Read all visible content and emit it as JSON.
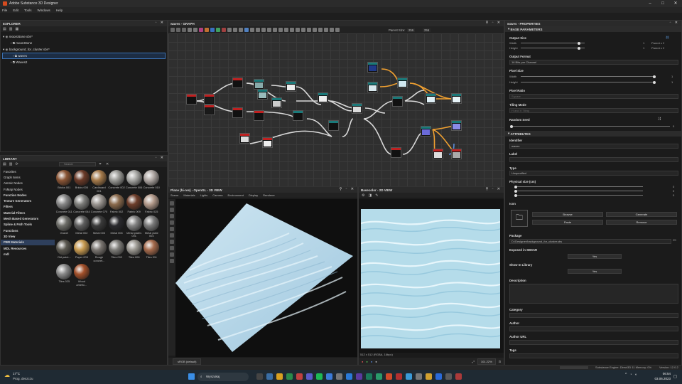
{
  "app": {
    "title": "Adobe Substance 3D Designer",
    "menu": [
      "File",
      "Edit",
      "Tools",
      "Windows",
      "Help"
    ]
  },
  "explorer": {
    "title": "EXPLORER",
    "items": [
      {
        "label": "moonStone.sbs*",
        "level": 0
      },
      {
        "label": "moonStone",
        "level": 1
      },
      {
        "label": "background_for_cluster.sbs*",
        "level": 0
      },
      {
        "label": "waves",
        "level": 1
      },
      {
        "label": "Waves2",
        "level": 1
      }
    ]
  },
  "library": {
    "title": "LIBRARY",
    "search_placeholder": "Search",
    "categories": [
      {
        "label": "Favorites",
        "bold": false
      },
      {
        "label": "Graph Items",
        "bold": false
      },
      {
        "label": "Atomic Nodes",
        "bold": false
      },
      {
        "label": "FxMap Nodes",
        "bold": false
      },
      {
        "label": "Function Nodes",
        "bold": true
      },
      {
        "label": "Texture Generators",
        "bold": true
      },
      {
        "label": "Filters",
        "bold": true
      },
      {
        "label": "Material Filters",
        "bold": true
      },
      {
        "label": "Mesh Based Generators",
        "bold": true
      },
      {
        "label": "Spline & Path Tools",
        "bold": true
      },
      {
        "label": "Functions",
        "bold": true
      },
      {
        "label": "3D View",
        "bold": true
      },
      {
        "label": "PBR Materials",
        "bold": true
      },
      {
        "label": "MDL Resources",
        "bold": true
      },
      {
        "label": "mdl",
        "bold": true
      }
    ],
    "materials": [
      {
        "label": "Bricks 001",
        "color": "#8a5535"
      },
      {
        "label": "Bricks 005",
        "color": "#6b3a28"
      },
      {
        "label": "Cardboard 001",
        "color": "#a57a4a"
      },
      {
        "label": "Concrete 002",
        "color": "#9a9a96"
      },
      {
        "label": "Concrete 006",
        "color": "#a8a8a5"
      },
      {
        "label": "Concrete 010",
        "color": "#b0a8a4"
      },
      {
        "label": "Concrete 011",
        "color": "#878787"
      },
      {
        "label": "Concrete 044",
        "color": "#7d7d7a"
      },
      {
        "label": "Concrete 070",
        "color": "#9a9590"
      },
      {
        "label": "Fabric 002",
        "color": "#8a6a4c"
      },
      {
        "label": "Fabric 009",
        "color": "#6d3d2a"
      },
      {
        "label": "Fabric 025",
        "color": "#b39a8b"
      },
      {
        "label": "Gravel",
        "color": "#6e6e69"
      },
      {
        "label": "Metal 002",
        "color": "#5e5e5e"
      },
      {
        "label": "Metal 003",
        "color": "#3a3a3a"
      },
      {
        "label": "Metal 006",
        "color": "#2a2a2e"
      },
      {
        "label": "Metal plates 001",
        "color": "#828282"
      },
      {
        "label": "Metal plate 004",
        "color": "#7a7a7a"
      },
      {
        "label": "Old paint...",
        "color": "#5b5850"
      },
      {
        "label": "Paper 005",
        "color": "#c79a50"
      },
      {
        "label": "Rough concret...",
        "color": "#7a7570"
      },
      {
        "label": "Tiles 002",
        "color": "#7d7c78"
      },
      {
        "label": "Tiles 008",
        "color": "#9b9891"
      },
      {
        "label": "Tiles 011",
        "color": "#a56a4c"
      },
      {
        "label": "Tiles 025",
        "color": "#8a8a8a"
      },
      {
        "label": "Wood americ...",
        "color": "#a3502a"
      }
    ]
  },
  "graph": {
    "title": "waves - GRAPH",
    "parent_size_label": "Parent Size:",
    "size_a": "256",
    "size_b": "256"
  },
  "view3d": {
    "title": "Plane (hi-res) - OpenGL - 3D VIEW",
    "menu": [
      "Scene",
      "Materials",
      "Lights",
      "Camera",
      "Environment",
      "Display",
      "Renderer"
    ],
    "colorspace": "sRGB (default)"
  },
  "view2d": {
    "title": "Basecolor - 2D VIEW",
    "status": "512 x 512 (RGBA, 16bpc)",
    "zoom": "101.22%"
  },
  "properties": {
    "title": "waves - PROPERTIES",
    "base_section": "BASE PARAMETERS",
    "output_size_label": "Output Size",
    "width_label": "Width",
    "height_label": "Height",
    "width_value": "1",
    "height_value": "1",
    "width_rel": "Parent x 2",
    "height_rel": "Parent x 2",
    "output_format_label": "Output Format",
    "output_format_value": "16 Bits per Channel",
    "pixel_size_label": "Pixel Size",
    "px_width": "1",
    "px_height": "1",
    "pixel_ratio_label": "Pixel Ratio",
    "pixel_ratio_value": "Square",
    "tiling_label": "Tiling Mode",
    "tiling_value": "H and V Tiling",
    "random_seed_label": "Random Seed",
    "random_seed_value": "0",
    "attributes_section": "ATTRIBUTES",
    "identifier_label": "Identifier",
    "identifier_value": "waves",
    "label_label": "Label",
    "type_label": "Type",
    "type_value": "Unspecified",
    "physical_size_label": "Physical size (cm)",
    "physical_size_values": [
      "0",
      "0",
      "0"
    ],
    "icon_label": "Icon",
    "browse_label": "Browse",
    "generate_label": "Generate",
    "paste_label": "Paste",
    "remove_label": "Remove",
    "package_label": "Package",
    "package_value": "D:/Designer/background_for_cluster.sbs",
    "exposed_label": "Exposed in SBSAR",
    "exposed_value": "Yes",
    "show_library_label": "Show In Library",
    "show_library_value": "Yes",
    "description_label": "Description",
    "category_label": "Category",
    "author_label": "Author",
    "author_url_label": "Author URL",
    "tags_label": "Tags"
  },
  "statusbar": {
    "engine": "Substance Engine: Direct3D 11  Memory: 0%",
    "version": "Version: 12.0.2"
  },
  "taskbar": {
    "weather_temp": "17°C",
    "weather_desc": "Prog. deszczu",
    "search_placeholder": "Wyszukaj",
    "time": "06:54",
    "date": "03.06.2023"
  }
}
